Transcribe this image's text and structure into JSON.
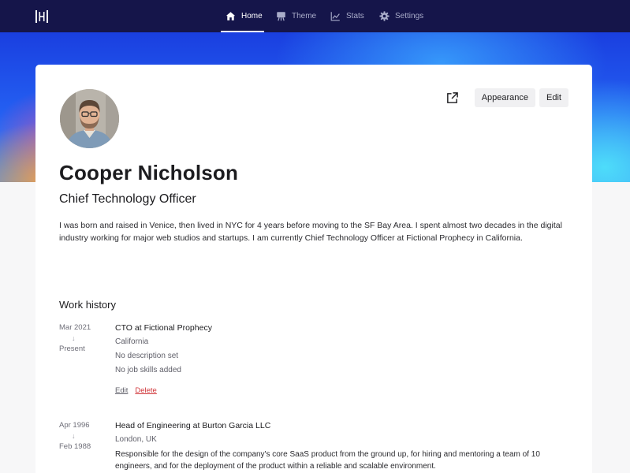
{
  "nav": {
    "items": [
      {
        "label": "Home",
        "icon": "home-icon",
        "active": true
      },
      {
        "label": "Theme",
        "icon": "easel-icon",
        "active": false
      },
      {
        "label": "Stats",
        "icon": "chart-icon",
        "active": false
      },
      {
        "label": "Settings",
        "icon": "gear-icon",
        "active": false
      }
    ]
  },
  "profile": {
    "name": "Cooper Nicholson",
    "title": "Chief Technology Officer",
    "bio": "I was born and raised in Venice, then lived in NYC for 4 years before moving to the SF Bay Area. I spent almost two decades in the digital industry working for major web studios and startups. I am currently Chief Technology Officer at Fictional Prophecy in California."
  },
  "actions": {
    "appearance_label": "Appearance",
    "edit_label": "Edit"
  },
  "work_history": {
    "heading": "Work history",
    "jobs": [
      {
        "start": "Mar 2021",
        "end": "Present",
        "title": "CTO at Fictional Prophecy",
        "location": "California",
        "description": "No description set",
        "skills": "No job skills added",
        "edit_label": "Edit",
        "delete_label": "Delete"
      },
      {
        "start": "Apr 1996",
        "end": "Feb 1988",
        "title": "Head of Engineering at Burton Garcia LLC",
        "location": "London, UK",
        "description": "Responsible for the design of the company's core SaaS product from the ground up, for hiring and mentoring a team of 10 engineers, and for the deployment of the product within a reliable and scalable environment."
      }
    ]
  },
  "colors": {
    "navbar": "#15154a",
    "delete_link": "#d0363a",
    "button_bg": "#f0f0f2"
  }
}
